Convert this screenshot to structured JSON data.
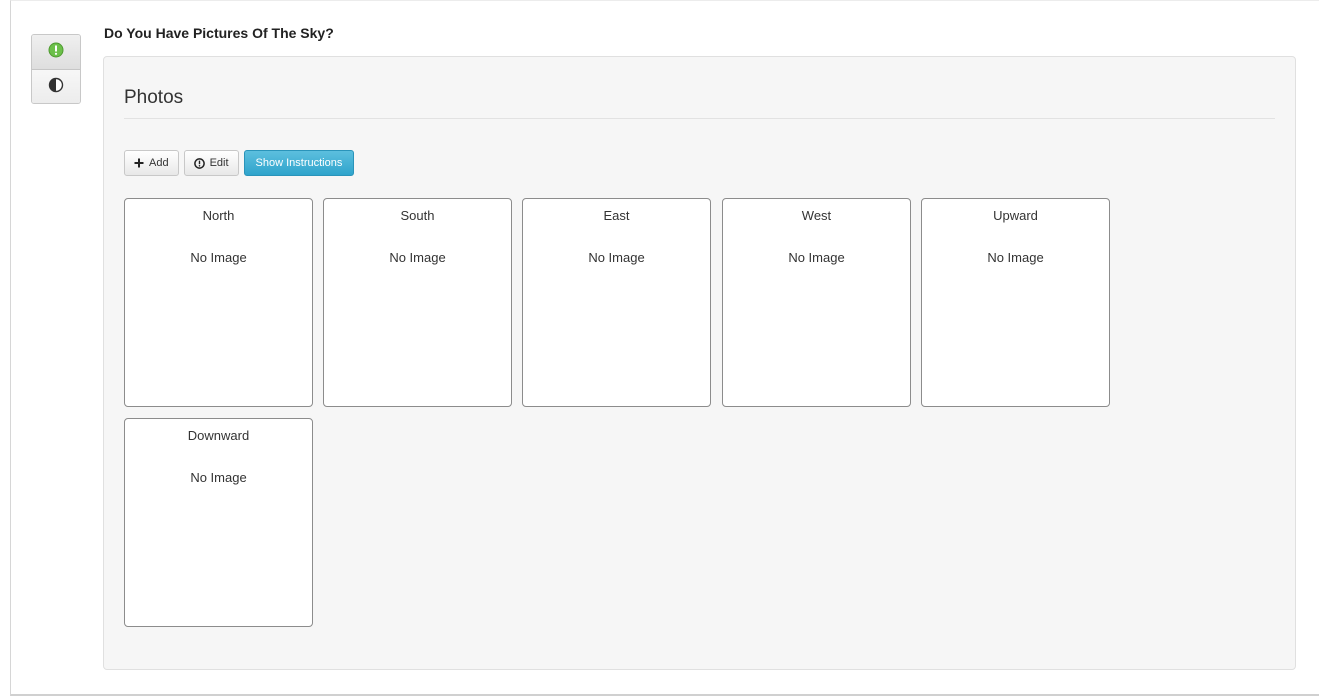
{
  "page": {
    "title": "Do You Have Pictures Of The Sky?"
  },
  "sidebar": {
    "items": [
      {
        "icon": "info-circle-icon",
        "color": "#6cc04a"
      },
      {
        "icon": "contrast-icon",
        "color": "#333333"
      }
    ]
  },
  "section": {
    "title": "Photos"
  },
  "toolbar": {
    "add_label": "Add",
    "add_icon": "plus-icon",
    "edit_label": "Edit",
    "edit_icon": "info-icon",
    "instructions_label": "Show Instructions",
    "accent": "#3aa8d0"
  },
  "photos": [
    {
      "direction": "North",
      "status": "No Image"
    },
    {
      "direction": "South",
      "status": "No Image"
    },
    {
      "direction": "East",
      "status": "No Image"
    },
    {
      "direction": "West",
      "status": "No Image"
    },
    {
      "direction": "Upward",
      "status": "No Image"
    },
    {
      "direction": "Downward",
      "status": "No Image"
    }
  ]
}
